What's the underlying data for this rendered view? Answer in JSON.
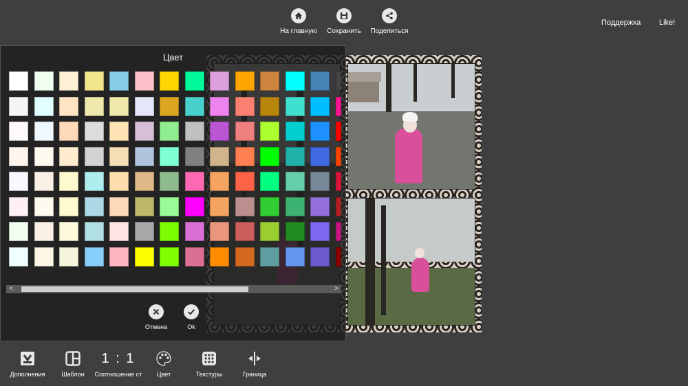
{
  "top_bar": {
    "home_label": "На главную",
    "save_label": "Сохранить",
    "share_label": "Поделиться",
    "support_label": "Поддержка",
    "like_label": "Like!"
  },
  "color_panel": {
    "title": "Цвет",
    "swatch_columns": [
      [
        "#ffffff",
        "#f5f5f5",
        "#fffafa",
        "#fff5ee",
        "#f8f8ff",
        "#fff0f5",
        "#f0fff0",
        "#f0ffff"
      ],
      [
        "#f0fff0",
        "#e0ffff",
        "#f0f8ff",
        "#fffaf0",
        "#faf0e6",
        "#fffaf0",
        "#faf0e6",
        "#fdf5e6"
      ],
      [
        "#ffefd5",
        "#ffe4c4",
        "#ffdab9",
        "#ffebcd",
        "#fffacd",
        "#fffacd",
        "#fff8dc",
        "#f5f5dc"
      ],
      [
        "#f0e68c",
        "#eee8aa",
        "#dcdcdc",
        "#d3d3d3",
        "#afeeee",
        "#add8e6",
        "#b0e0e6",
        "#87cefa"
      ],
      [
        "#87ceeb",
        "#eee8aa",
        "#ffe4b5",
        "#f5deb3",
        "#ffdead",
        "#ffdab9",
        "#ffe4e1",
        "#ffb6c1"
      ],
      [
        "#ffc0cb",
        "#e6e6fa",
        "#d8bfd8",
        "#b0c4de",
        "#deb887",
        "#bdb76b",
        "#a9a9a9",
        "#ffff00"
      ],
      [
        "#ffd700",
        "#daa520",
        "#90ee90",
        "#7fffd4",
        "#8fbc8f",
        "#98fb98",
        "#7cfc00",
        "#7fff00"
      ],
      [
        "#00fa9a",
        "#48d1cc",
        "#c0c0c0",
        "#808080",
        "#ff69b4",
        "#ff00ff",
        "#da70d6",
        "#db7093"
      ],
      [
        "#dda0dd",
        "#ee82ee",
        "#ba55d3",
        "#d2b48c",
        "#f4a460",
        "#f4a460",
        "#e9967a",
        "#ff8c00"
      ],
      [
        "#ffa500",
        "#fa8072",
        "#f08080",
        "#ff7f50",
        "#ff6347",
        "#bc8f8f",
        "#cd5c5c",
        "#d2691e"
      ],
      [
        "#cd853f",
        "#b8860b",
        "#adff2f",
        "#00ff00",
        "#00ff7f",
        "#32cd32",
        "#9acd32",
        "#5f9ea0"
      ],
      [
        "#00ffff",
        "#40e0d0",
        "#00ced1",
        "#20b2aa",
        "#66cdaa",
        "#3cb371",
        "#228b22",
        "#6495ed"
      ],
      [
        "#4682b4",
        "#00bfff",
        "#1e90ff",
        "#4169e1",
        "#778899",
        "#9370db",
        "#7b68ee",
        "#6a5acd"
      ]
    ],
    "partial_column": [
      "#444444",
      "#ff1493",
      "#ff0000",
      "#ff4500",
      "#dc143c",
      "#b22222",
      "#c71585",
      "#8b0000"
    ],
    "scroll_left_glyph": "<",
    "scroll_right_glyph": ">",
    "scroll_position_fraction": 0.0,
    "cancel_label": "Отмена",
    "ok_label": "Ok"
  },
  "bottom_toolbar": {
    "addons_label": "Дополнения",
    "template_label": "Шаблон",
    "ratio_value": "1 : 1",
    "ratio_label": "Соотношение ст",
    "color_label": "Цвет",
    "textures_label": "Текстуры",
    "border_label": "Граница"
  },
  "icons": {
    "home": "home-icon",
    "save": "floppy-disk-icon",
    "share": "share-icon",
    "cancel": "close-icon",
    "ok": "checkmark-icon",
    "addons": "download-box-icon",
    "template": "layout-icon",
    "color": "palette-icon",
    "textures": "grid-dots-icon",
    "border": "split-arrows-icon"
  }
}
